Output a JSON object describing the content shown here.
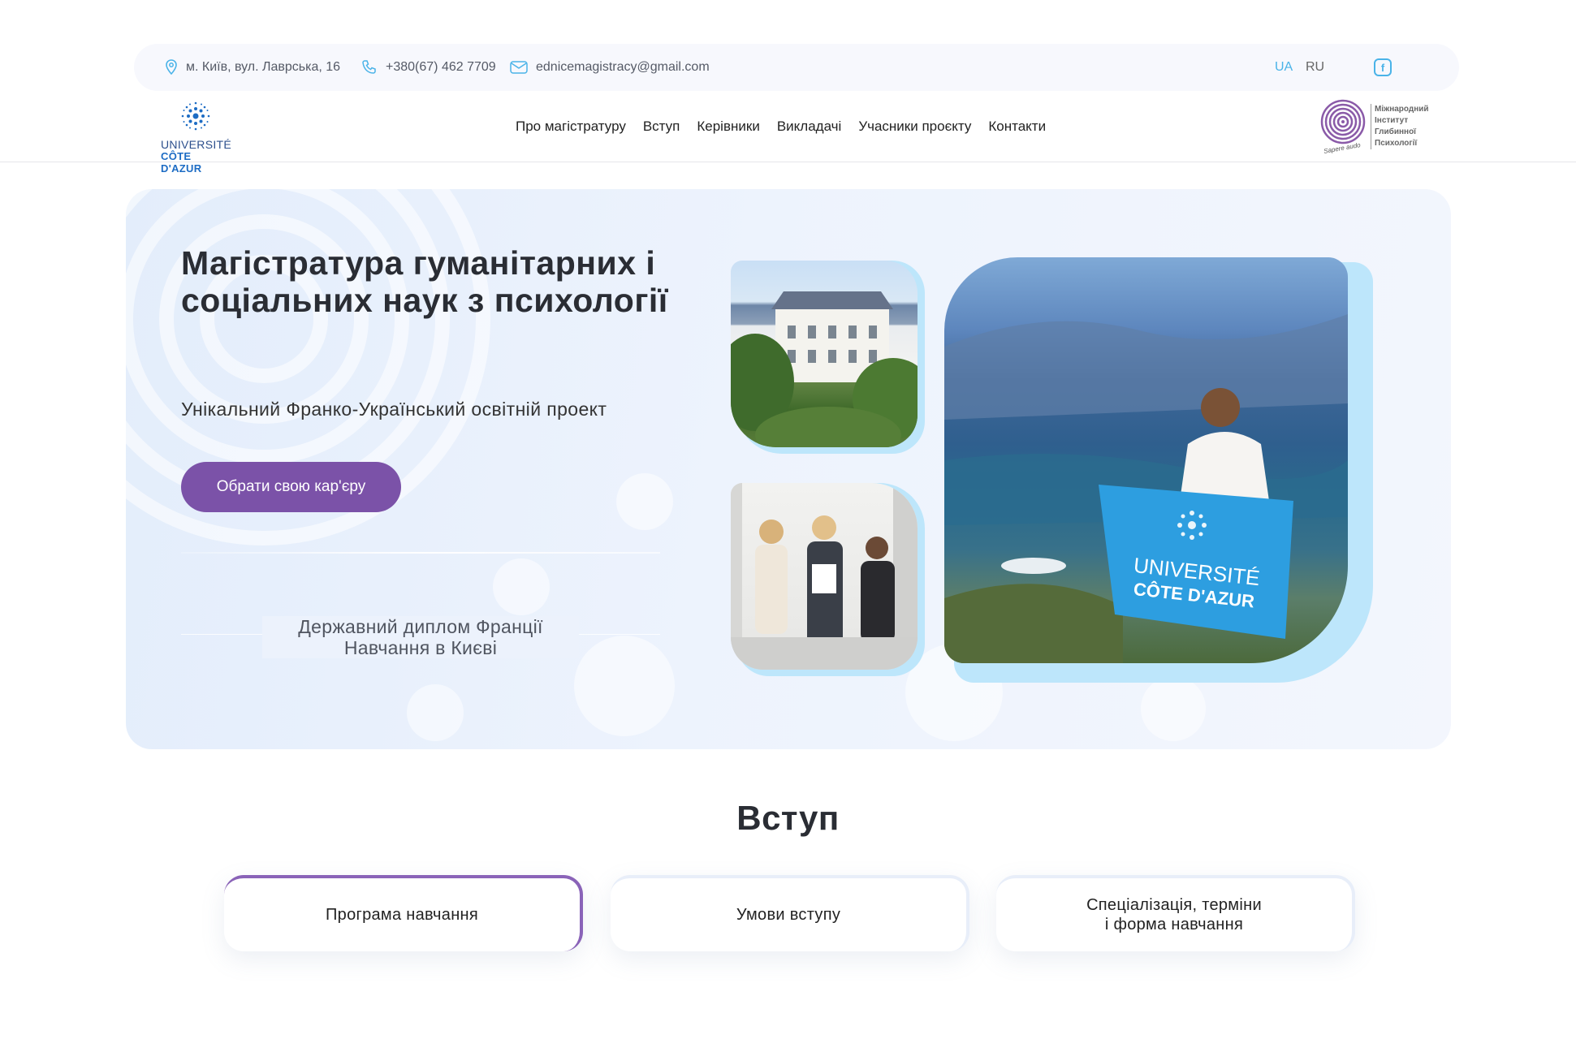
{
  "topbar": {
    "address": "м. Київ, вул. Лаврська, 16",
    "phone": "+380(67) 462 7709",
    "email": "ednicemagistracy@gmail.com",
    "lang_ua": "UA",
    "lang_ru": "RU",
    "facebook_icon": "f"
  },
  "nav": {
    "logo_left_line1": "UNIVERSITÉ",
    "logo_left_line2": "CÔTE D'AZUR",
    "items": [
      "Про магістратуру",
      "Вступ",
      "Керівники",
      "Викладачі",
      "Учасники проєкту",
      "Контакти"
    ],
    "logo_right_lines": [
      "Міжнародний",
      "Інститут",
      "Глибинної",
      "Психології"
    ],
    "logo_right_motto": "Sapere audo"
  },
  "hero": {
    "title": "Магістратура гуманітарних і соціальних наук з психології",
    "subtitle": "Унікальний Франко-Український освітній проект",
    "cta": "Обрати свою кар'єру",
    "diploma_line1": "Державний диплом Франції",
    "diploma_line2": "Навчання в Києві",
    "flag_line1": "UNIVERSITÉ",
    "flag_line2": "CÔTE D'AZUR"
  },
  "section": {
    "title": "Вступ",
    "tabs": [
      "Програма навчання",
      "Умови вступу",
      "Спеціалізація, терміни\nі форма навчання"
    ]
  },
  "colors": {
    "accent_purple": "#7b52a8",
    "accent_blue": "#4ab3e8",
    "photo_shadow": "#bde6fb"
  }
}
